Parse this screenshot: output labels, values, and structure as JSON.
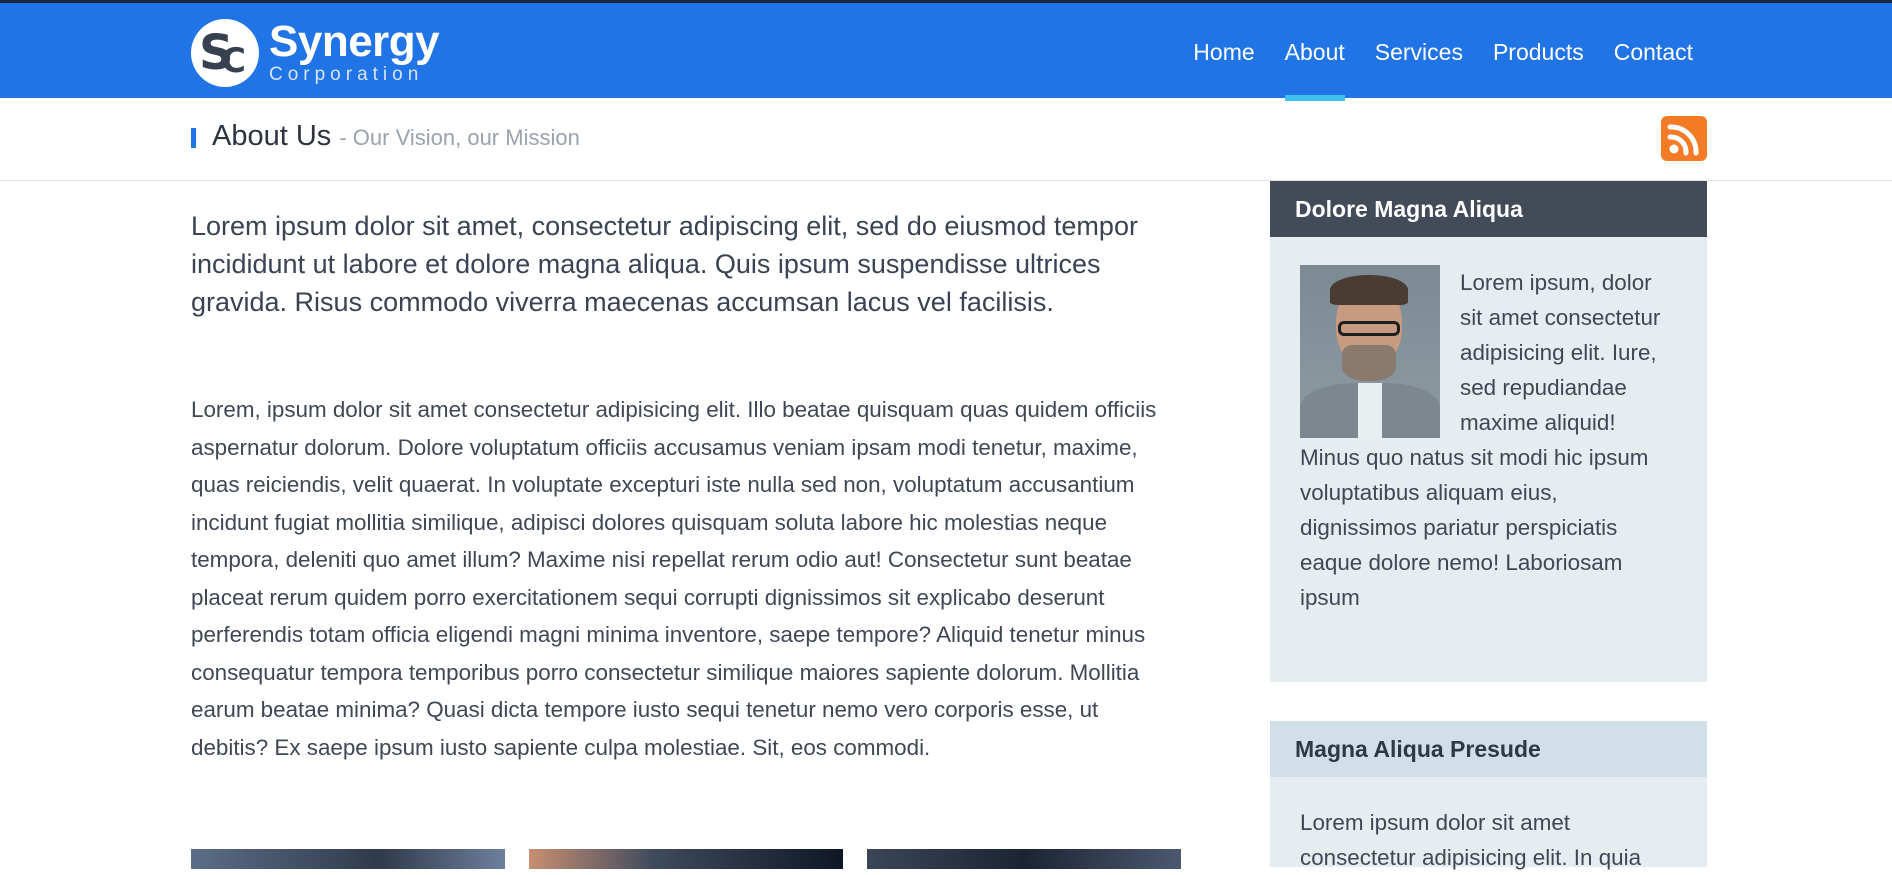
{
  "header": {
    "logo_name": "Synergy",
    "logo_sub": "Corporation",
    "logo_mark": {
      "s": "S",
      "c": "C"
    },
    "nav": [
      {
        "label": "Home"
      },
      {
        "label": "About",
        "active": true
      },
      {
        "label": "Services"
      },
      {
        "label": "Products"
      },
      {
        "label": "Contact"
      }
    ],
    "colors": {
      "bar": "#2174e6",
      "active_indicator": "#3dc2f0"
    }
  },
  "title_bar": {
    "title": "About Us",
    "subtitle": "- Our Vision, our Mission",
    "rss_icon": "rss-icon"
  },
  "main": {
    "lead": "Lorem ipsum dolor sit amet, consectetur adipiscing elit, sed do eiusmod tempor incididunt ut labore et dolore magna aliqua. Quis ipsum suspendisse ultrices gravida. Risus commodo viverra maecenas accumsan lacus vel facilisis.",
    "body": "Lorem, ipsum dolor sit amet consectetur adipisicing elit. Illo beatae quisquam quas quidem officiis aspernatur dolorum. Dolore voluptatum officiis accusamus veniam ipsam modi tenetur, maxime, quas reiciendis, velit quaerat. In voluptate excepturi iste nulla sed non, voluptatum accusantium incidunt fugiat mollitia similique, adipisci dolores quisquam soluta labore hic molestias neque tempora, deleniti quo amet illum? Maxime nisi repellat rerum odio aut! Consectetur sunt beatae placeat rerum quidem porro exercitationem sequi corrupti dignissimos sit explicabo deserunt perferendis totam officia eligendi magni minima inventore, saepe tempore? Aliquid tenetur minus consequatur tempora temporibus porro consectetur similique maiores sapiente dolorum. Mollitia earum beatae minima? Quasi dicta tempore iusto sequi tenetur nemo vero corporis esse, ut debitis? Ex saepe ipsum iusto sapiente culpa molestiae. Sit, eos commodi."
  },
  "sidebar": {
    "box1": {
      "title": "Dolore Magna Aliqua",
      "text": "Lorem ipsum, dolor sit amet consectetur adipisicing elit. Iure, sed repudiandae maxime aliquid! Minus quo natus sit modi hic ipsum voluptatibus aliquam eius, dignissimos pariatur perspiciatis eaque dolore nemo! Laboriosam ipsum"
    },
    "box2": {
      "title": "Magna Aliqua Presude",
      "text": "Lorem ipsum dolor sit amet consectetur adipisicing elit. In quia"
    }
  }
}
